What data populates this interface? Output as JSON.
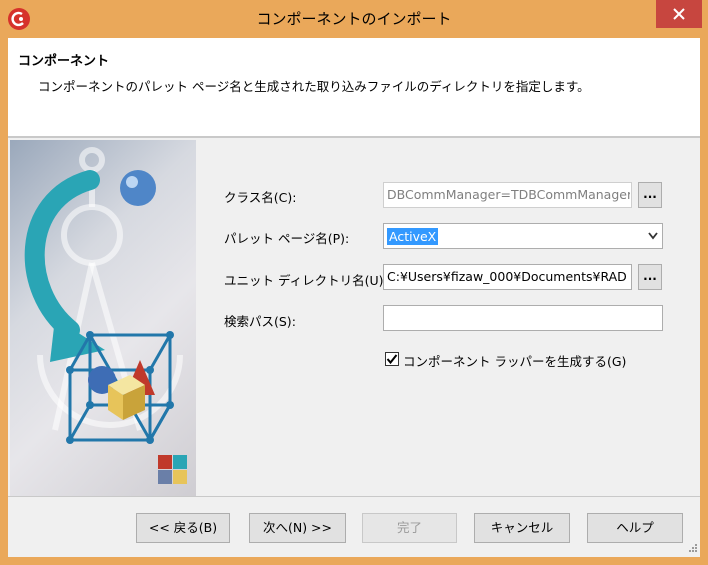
{
  "window": {
    "title": "コンポーネントのインポート",
    "close_glyph": "✕"
  },
  "header": {
    "title": "コンポーネント",
    "description": "コンポーネントのパレット ページ名と生成された取り込みファイルのディレクトリを指定します。"
  },
  "form": {
    "class_name": {
      "label": "クラス名(C):",
      "value": "DBCommManager=TDBCommManager",
      "browse": "..."
    },
    "palette_page": {
      "label": "パレット ページ名(P):",
      "value": "ActiveX"
    },
    "unit_dir": {
      "label": "ユニット ディレクトリ名(U):",
      "value": "C:¥Users¥fizaw_000¥Documents¥RAD",
      "browse": "..."
    },
    "search_path": {
      "label": "検索パス(S):",
      "value": ""
    },
    "wrapper": {
      "label": "コンポーネント ラッパーを生成する(G)",
      "checked": true
    }
  },
  "buttons": {
    "back": "<< 戻る(B)",
    "next": "次へ(N) >>",
    "finish": "完了",
    "cancel": "キャンセル",
    "help": "ヘルプ"
  },
  "colors": {
    "titlebar": "#eaa85a",
    "close": "#c7463f",
    "selection": "#3399ff",
    "art_arrow": "#2aa5b5",
    "art_cube": "#2277aa"
  }
}
